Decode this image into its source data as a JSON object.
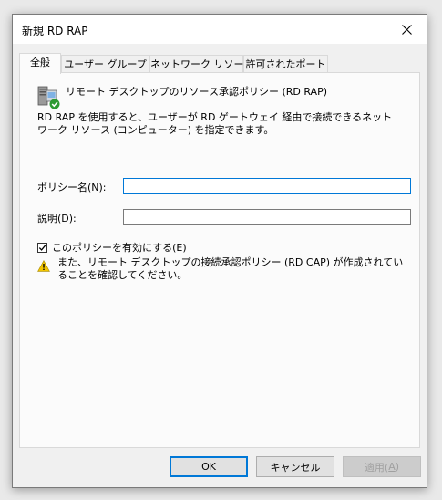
{
  "window": {
    "title": "新規 RD RAP",
    "close": "✕"
  },
  "tabs": [
    {
      "label": "全般"
    },
    {
      "label": "ユーザー グループ"
    },
    {
      "label": "ネットワーク リソース"
    },
    {
      "label": "許可されたポート"
    }
  ],
  "panel": {
    "header": "リモート デスクトップのリソース承認ポリシー (RD RAP)",
    "description": "RD RAP を使用すると、ユーザーが RD ゲートウェイ 経由で接続できるネットワーク リソース (コンピューター) を指定できます。",
    "policy_name_label": "ポリシー名(N):",
    "policy_name_value": "",
    "description_label": "説明(D):",
    "description_value": "",
    "enable_checkbox_label": "このポリシーを有効にする(E)",
    "enable_checked": true,
    "warning_text": "また、リモート デスクトップの接続承認ポリシー (RD CAP) が作成されていることを確認してください。"
  },
  "buttons": {
    "ok": "OK",
    "cancel": "キャンセル",
    "apply_prefix": "適用(",
    "apply_key": "A",
    "apply_suffix": ")"
  },
  "colors": {
    "accent": "#0078d7",
    "warning": "#f2c500"
  }
}
